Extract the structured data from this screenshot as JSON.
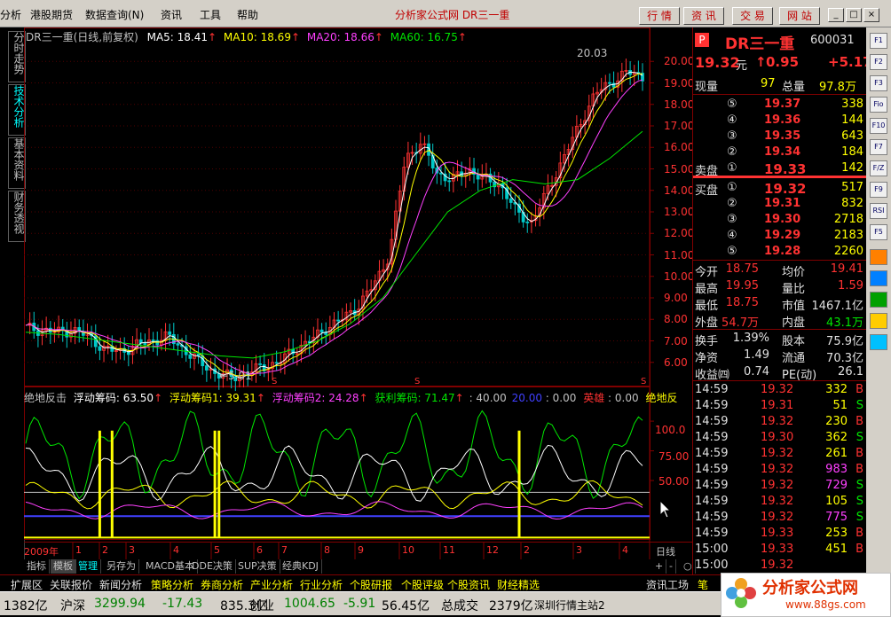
{
  "menu": {
    "items": [
      "分析",
      "港股期货",
      "数据查询(N)",
      "资讯",
      "工具",
      "帮助"
    ],
    "title": "分析家公式网 DR三一重",
    "buttons": [
      "行 情",
      "资 讯",
      "交 易",
      "网 站"
    ],
    "window_controls": [
      "_",
      "□",
      "×"
    ]
  },
  "left_tabs": [
    "分时走势",
    "技术分析",
    "基本资料",
    "财务透视"
  ],
  "main_chart": {
    "header": {
      "name": "DR三一重(日线,前复权)",
      "ma5": "MA5: 18.41",
      "ma10": "MA10: 18.69",
      "ma20": "MA20: 18.66",
      "ma60": "MA60: 16.75"
    },
    "y_ticks": [
      "20.00",
      "19.00",
      "18.00",
      "17.00",
      "16.00",
      "15.00",
      "14.00",
      "13.00",
      "12.00",
      "11.00",
      "10.00",
      "9.00",
      "8.00",
      "7.00",
      "6.00"
    ],
    "high_label": "20.03",
    "low_label": "←5.01",
    "s_marks": [
      "S",
      "S",
      "S"
    ]
  },
  "indicator": {
    "header": [
      "绝地反击",
      "浮动筹码: 63.50",
      "浮动筹码1: 39.31",
      "浮动筹码2: 24.28",
      "获利筹码: 71.47",
      ": 40.00",
      "20.00",
      ": 0.00",
      "英雄",
      ": 0.00",
      "绝地反"
    ],
    "y_ticks": [
      "100.0",
      "75.00",
      "50.00"
    ]
  },
  "x_axis": {
    "labels": [
      "2009年",
      "1",
      "2",
      "3",
      "4",
      "5",
      "6",
      "7",
      "8",
      "9",
      "10",
      "11",
      "12",
      "2",
      "3",
      "4"
    ],
    "period": "日线"
  },
  "chart_data": {
    "type": "line",
    "title": "DR三一重(日线,前复权)",
    "series": [
      {
        "name": "MA5",
        "last": 18.41
      },
      {
        "name": "MA10",
        "last": 18.69
      },
      {
        "name": "MA20",
        "last": 18.66
      },
      {
        "name": "MA60",
        "last": 16.75
      }
    ],
    "price_path": [
      7.6,
      7.5,
      7.4,
      7.5,
      7.2,
      6.6,
      6.5,
      6.8,
      7.0,
      7.2,
      6.6,
      6.0,
      5.5,
      5.3,
      5.5,
      5.8,
      6.0,
      6.6,
      7.0,
      7.6,
      8.0,
      8.6,
      9.6,
      11.0,
      15.5,
      16.2,
      14.8,
      14.5,
      15.0,
      14.5,
      14.3,
      13.0,
      12.5,
      14.0,
      15.5,
      17.0,
      18.5,
      19.0,
      19.5,
      19.3
    ],
    "ma60_path": [
      7.4,
      7.3,
      7.1,
      6.9,
      6.7,
      6.5,
      6.3,
      6.2,
      6.5,
      7.0,
      7.8,
      9.0,
      11.0,
      13.0,
      14.0,
      14.5,
      14.3,
      14.5,
      15.5,
      16.75
    ],
    "ylim": [
      5.0,
      21.0
    ],
    "ylabel": "",
    "xlabel": ""
  },
  "quote": {
    "flag": "P",
    "name": "DR三一重",
    "code": "600031",
    "price": "19.32",
    "unit": "元",
    "change": "0.95",
    "pct": "+5.17",
    "volume_now_label": "现量",
    "volume_now": "97",
    "volume_total_label": "总量",
    "volume_total": "97.8万",
    "sells": [
      {
        "lv": "⑤",
        "price": "19.37",
        "vol": "338"
      },
      {
        "lv": "④",
        "price": "19.36",
        "vol": "144"
      },
      {
        "lv": "③",
        "price": "19.35",
        "vol": "643"
      },
      {
        "lv": "②",
        "price": "19.34",
        "vol": "184"
      },
      {
        "lv": "①",
        "price": "19.33",
        "vol": "142"
      }
    ],
    "sell_label": "卖盘",
    "buy_label": "买盘",
    "buys": [
      {
        "lv": "①",
        "price": "19.32",
        "vol": "517"
      },
      {
        "lv": "②",
        "price": "19.31",
        "vol": "832"
      },
      {
        "lv": "③",
        "price": "19.30",
        "vol": "2718"
      },
      {
        "lv": "④",
        "price": "19.29",
        "vol": "2183"
      },
      {
        "lv": "⑤",
        "price": "19.28",
        "vol": "2260"
      }
    ],
    "stats": [
      {
        "l1": "今开",
        "v1": "18.75",
        "l2": "均价",
        "v2": "19.41"
      },
      {
        "l1": "最高",
        "v1": "19.95",
        "l2": "量比",
        "v2": "1.59"
      },
      {
        "l1": "最低",
        "v1": "18.75",
        "l2": "市值",
        "v2": "1467.1亿"
      },
      {
        "l1": "外盘",
        "v1": "54.7万",
        "l2": "内盘",
        "v2": "43.1万"
      }
    ],
    "fin": [
      {
        "l1": "换手",
        "v1": "1.39%",
        "l2": "股本",
        "v2": "75.9亿"
      },
      {
        "l1": "净资",
        "v1": "1.49",
        "l2": "流通",
        "v2": "70.3亿"
      },
      {
        "l1": "收益㈣",
        "v1": "0.74",
        "l2": "PE(动)",
        "v2": "26.1"
      }
    ],
    "ticks": [
      {
        "t": "14:59",
        "p": "19.32",
        "v": "332",
        "s": "B"
      },
      {
        "t": "14:59",
        "p": "19.31",
        "v": "51",
        "s": "S"
      },
      {
        "t": "14:59",
        "p": "19.32",
        "v": "230",
        "s": "B"
      },
      {
        "t": "14:59",
        "p": "19.30",
        "v": "362",
        "s": "S"
      },
      {
        "t": "14:59",
        "p": "19.32",
        "v": "261",
        "s": "B"
      },
      {
        "t": "14:59",
        "p": "19.32",
        "v": "983",
        "s": "B"
      },
      {
        "t": "14:59",
        "p": "19.32",
        "v": "729",
        "s": "S"
      },
      {
        "t": "14:59",
        "p": "19.32",
        "v": "105",
        "s": "S"
      },
      {
        "t": "14:59",
        "p": "19.32",
        "v": "775",
        "s": "S"
      },
      {
        "t": "14:59",
        "p": "19.33",
        "v": "253",
        "s": "B"
      },
      {
        "t": "15:00",
        "p": "19.33",
        "v": "451",
        "s": "B"
      },
      {
        "t": "15:00",
        "p": "19.32",
        "v": "",
        "s": ""
      }
    ]
  },
  "right_tools": [
    "F1",
    "F2",
    "F3",
    "Fio",
    "F10",
    "F7",
    "F/Z",
    "F9",
    "RSI",
    "F5"
  ],
  "bottom_tabs": [
    "指标",
    "模板",
    "管理",
    "另存为",
    "MACD基本",
    "DDE决策",
    "SUP决策",
    "经典KDJ"
  ],
  "tab_controls": [
    "+",
    "-",
    "○"
  ],
  "func_bar": [
    "扩展区",
    "关联报价",
    "新闻分析",
    "策略分析",
    "券商分析",
    "产业分析",
    "行业分析",
    "个股研报",
    "个股评级",
    "个股资讯",
    "财经精选",
    "资讯工场",
    "笔"
  ],
  "status": {
    "v0": "1382亿",
    "sh_label": "沪深",
    "sh_val": "3299.94",
    "sh_chg": "-17.43",
    "sh_amt": "835.3亿",
    "cy_label": "创业",
    "cy_val": "1004.65",
    "cy_chg": "-5.91",
    "cy_amt": "56.45亿",
    "total_label": "总成交",
    "total_val": "2379亿",
    "server": "深圳行情主站2",
    "logo": "分析家公式网",
    "site": "www.88gs.com"
  }
}
